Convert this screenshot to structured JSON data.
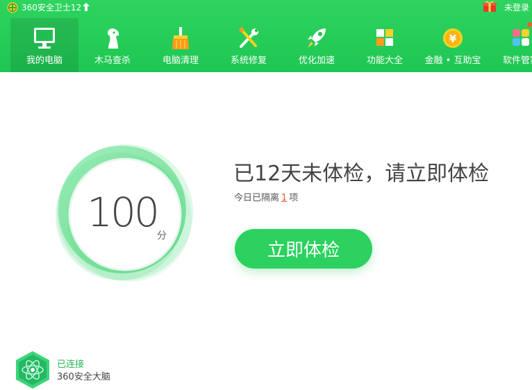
{
  "titlebar": {
    "app_title": "360安全卫士12",
    "login_label": "未登录"
  },
  "nav": {
    "active_index": 0,
    "tabs": [
      {
        "label": "我的电脑",
        "icon": "monitor-icon"
      },
      {
        "label": "木马查杀",
        "icon": "trojan-horse-icon"
      },
      {
        "label": "电脑清理",
        "icon": "broom-icon"
      },
      {
        "label": "系统修复",
        "icon": "wrench-screwdriver-icon"
      },
      {
        "label": "优化加速",
        "icon": "rocket-icon"
      },
      {
        "label": "功能大全",
        "icon": "grid-apps-icon"
      },
      {
        "label": "金融 • 互助宝",
        "icon": "yuan-coin-icon"
      },
      {
        "label": "软件管家",
        "icon": "software-manager-icon"
      }
    ]
  },
  "main": {
    "score": "100",
    "score_unit": "分",
    "headline": "已12天未体检，请立即体检",
    "sub_prefix": "今日已隔离",
    "sub_count": "1",
    "sub_suffix": "项",
    "check_button": "立即体检"
  },
  "status": {
    "connected": "已连接",
    "brain_name": "360安全大脑"
  },
  "colors": {
    "brand_green": "#22c957",
    "button_green": "#2cd15f",
    "count_orange": "#e8552d"
  }
}
